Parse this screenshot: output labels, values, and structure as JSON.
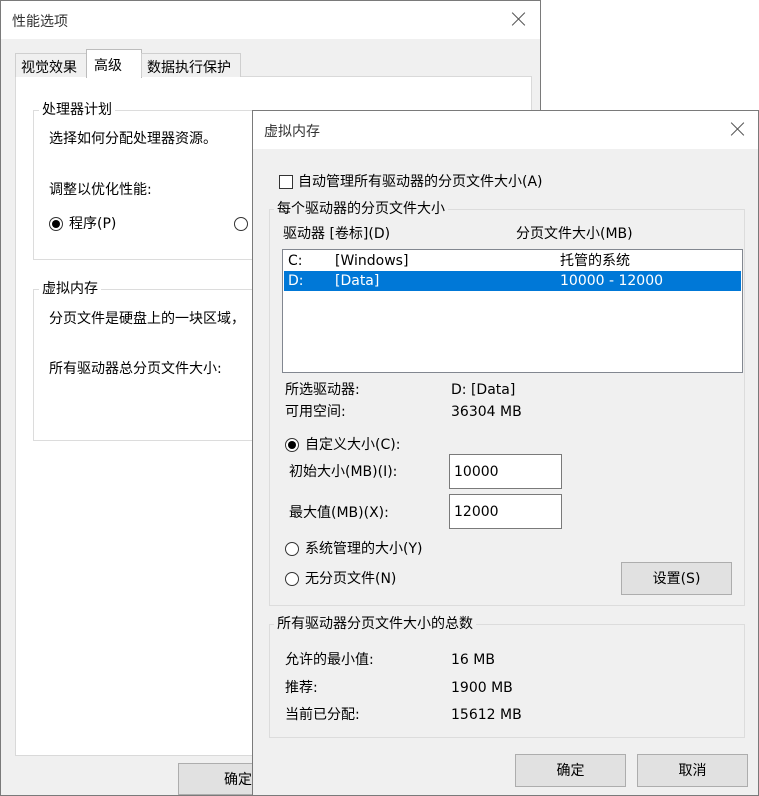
{
  "perf_window": {
    "title": "性能选项",
    "tabs": [
      {
        "label": "视觉效果"
      },
      {
        "label": "高级"
      },
      {
        "label": "数据执行保护"
      }
    ],
    "processor_group": {
      "legend": "处理器计划",
      "desc": "选择如何分配处理器资源。",
      "adjust_label": "调整以优化性能:",
      "programs_option": "程序(P)"
    },
    "vm_group": {
      "legend": "虚拟内存",
      "desc": "分页文件是硬盘上的一块区域，",
      "total_label": "所有驱动器总分页文件大小:"
    },
    "ok_button": "确定"
  },
  "vm_dialog": {
    "title": "虚拟内存",
    "auto_manage": {
      "label": "自动管理所有驱动器的分页文件大小(A)",
      "checked": false
    },
    "per_drive_group": {
      "legend": "每个驱动器的分页文件大小",
      "col_drive": "驱动器 [卷标](D)",
      "col_size": "分页文件大小(MB)",
      "drives": [
        {
          "letter": "C:",
          "label": "[Windows]",
          "size": "托管的系统",
          "selected": false
        },
        {
          "letter": "D:",
          "label": "[Data]",
          "size": "10000 - 12000",
          "selected": true
        }
      ],
      "selected_drive_label": "所选驱动器:",
      "selected_drive_value": "D:  [Data]",
      "free_space_label": "可用空间:",
      "free_space_value": "36304 MB",
      "custom_size_option": "自定义大小(C):",
      "initial_size_label": "初始大小(MB)(I):",
      "initial_size_value": "10000",
      "max_size_label": "最大值(MB)(X):",
      "max_size_value": "12000",
      "system_managed_option": "系统管理的大小(Y)",
      "no_paging_option": "无分页文件(N)",
      "set_button": "设置(S)"
    },
    "totals_group": {
      "legend": "所有驱动器分页文件大小的总数",
      "min_label": "允许的最小值:",
      "min_value": "16 MB",
      "recommended_label": "推荐:",
      "recommended_value": "1900 MB",
      "current_label": "当前已分配:",
      "current_value": "15612 MB"
    },
    "ok_button": "确定",
    "cancel_button": "取消"
  }
}
